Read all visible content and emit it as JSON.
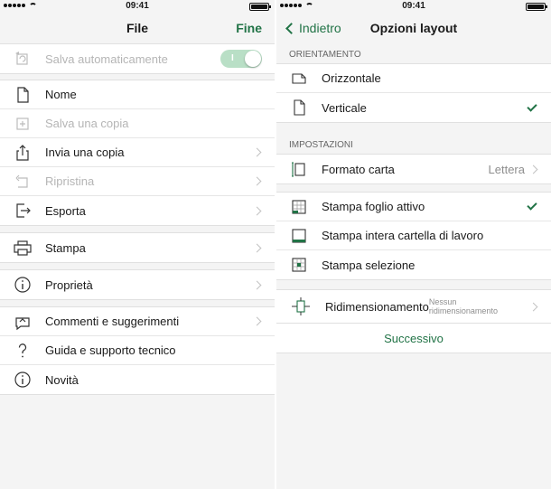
{
  "left": {
    "status": {
      "time": "09:41"
    },
    "title": "File",
    "done_label": "Fine",
    "autosave": {
      "label": "Salva automaticamente",
      "state": "on"
    },
    "group1": [
      {
        "label": "Nome",
        "icon": "document-icon",
        "disabled": false,
        "chevron": false
      },
      {
        "label": "Salva una copia",
        "icon": "save-copy-icon",
        "disabled": true,
        "chevron": false
      },
      {
        "label": "Invia una copia",
        "icon": "share-icon",
        "disabled": false,
        "chevron": true
      },
      {
        "label": "Ripristina",
        "icon": "restore-icon",
        "disabled": true,
        "chevron": true
      },
      {
        "label": "Esporta",
        "icon": "export-icon",
        "disabled": false,
        "chevron": true
      }
    ],
    "print_label": "Stampa",
    "properties_label": "Proprietà",
    "group4": [
      {
        "label": "Commenti e suggerimenti",
        "icon": "feedback-icon",
        "chevron": true
      },
      {
        "label": "Guida e supporto tecnico",
        "icon": "help-icon",
        "chevron": false
      },
      {
        "label": "Novità",
        "icon": "info-icon",
        "chevron": false
      }
    ]
  },
  "right": {
    "status": {
      "time": "09:41"
    },
    "back_label": "Indietro",
    "title": "Opzioni layout",
    "orientation_header": "ORIENTAMENTO",
    "orientation": [
      {
        "label": "Orizzontale",
        "selected": false
      },
      {
        "label": "Verticale",
        "selected": true
      }
    ],
    "settings_header": "IMPOSTAZIONI",
    "paper_format": {
      "label": "Formato carta",
      "value": "Lettera"
    },
    "print_scope": [
      {
        "label": "Stampa foglio attivo",
        "selected": true
      },
      {
        "label": "Stampa intera cartella di lavoro",
        "selected": false
      },
      {
        "label": "Stampa selezione",
        "selected": false
      }
    ],
    "scaling": {
      "label": "Ridimensionamento",
      "value": "Nessun ridimensionamento"
    },
    "next_label": "Successivo"
  },
  "colors": {
    "accent": "#217346",
    "toggle_on": "#b9dfc6"
  }
}
